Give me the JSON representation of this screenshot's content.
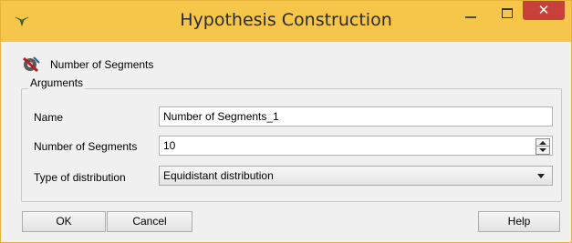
{
  "window": {
    "title": "Hypothesis Construction",
    "close_glyph": "✕",
    "icons": [
      "app-icon",
      "minimize-icon",
      "maximize-icon",
      "close-icon"
    ]
  },
  "hypothesis": {
    "label": "Number of Segments",
    "icon": "hypothesis-gear-icon"
  },
  "arguments": {
    "title": "Arguments",
    "name_label": "Name",
    "name_value": "Number of Segments_1",
    "segments_label": "Number of Segments",
    "segments_value": "10",
    "distribution_label": "Type of distribution",
    "distribution_value": "Equidistant distribution"
  },
  "buttons": {
    "ok": "OK",
    "cancel": "Cancel",
    "help": "Help"
  },
  "colors": {
    "titlebar": "#f6c64a",
    "close": "#c7403a"
  }
}
